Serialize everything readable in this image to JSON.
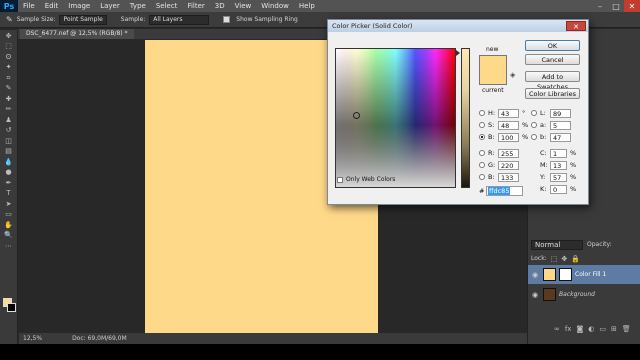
{
  "menu": {
    "logo": "Ps",
    "items": [
      "File",
      "Edit",
      "Image",
      "Layer",
      "Type",
      "Select",
      "Filter",
      "3D",
      "View",
      "Window",
      "Help"
    ]
  },
  "options_bar": {
    "sample_size_label": "Sample Size:",
    "sample_size_value": "Point Sample",
    "sample_label": "Sample:",
    "sample_value": "All Layers",
    "sampling_ring_label": "Show Sampling Ring"
  },
  "document": {
    "tab_label": "DSC_6477.nef @ 12,5% (RGB/8) *",
    "zoom": "12,5%",
    "doc_info": "Doc: 69,0M/69,0M"
  },
  "layers_panel": {
    "blend_mode": "Normal",
    "opacity_label": "Opacity:",
    "lock_label": "Lock:",
    "layers": [
      {
        "name": "Color Fill 1",
        "selected": true
      },
      {
        "name": "Background",
        "selected": false
      }
    ]
  },
  "dialog": {
    "title": "Color Picker (Solid Color)",
    "new_label": "new",
    "current_label": "current",
    "only_web_colors": "Only Web Colors",
    "buttons": {
      "ok": "OK",
      "cancel": "Cancel",
      "add_to_swatches": "Add to Swatches",
      "color_libraries": "Color Libraries"
    },
    "fields": {
      "H": {
        "label": "H:",
        "value": "43",
        "unit": "°"
      },
      "S": {
        "label": "S:",
        "value": "48",
        "unit": "%"
      },
      "B": {
        "label": "B:",
        "value": "100",
        "unit": "%"
      },
      "R": {
        "label": "R:",
        "value": "255",
        "unit": ""
      },
      "G": {
        "label": "G:",
        "value": "220",
        "unit": ""
      },
      "Bl": {
        "label": "B:",
        "value": "133",
        "unit": ""
      },
      "L": {
        "label": "L:",
        "value": "89",
        "unit": ""
      },
      "a": {
        "label": "a:",
        "value": "5",
        "unit": ""
      },
      "b": {
        "label": "b:",
        "value": "47",
        "unit": ""
      },
      "C": {
        "label": "C:",
        "value": "1",
        "unit": "%"
      },
      "M": {
        "label": "M:",
        "value": "13",
        "unit": "%"
      },
      "Y": {
        "label": "Y:",
        "value": "57",
        "unit": "%"
      },
      "K": {
        "label": "K:",
        "value": "0",
        "unit": "%"
      }
    },
    "hex_label": "#",
    "hex_value": "ffdc85"
  },
  "colors": {
    "picked": "#ffd98a",
    "selection_blue": "#5d7ba3"
  }
}
